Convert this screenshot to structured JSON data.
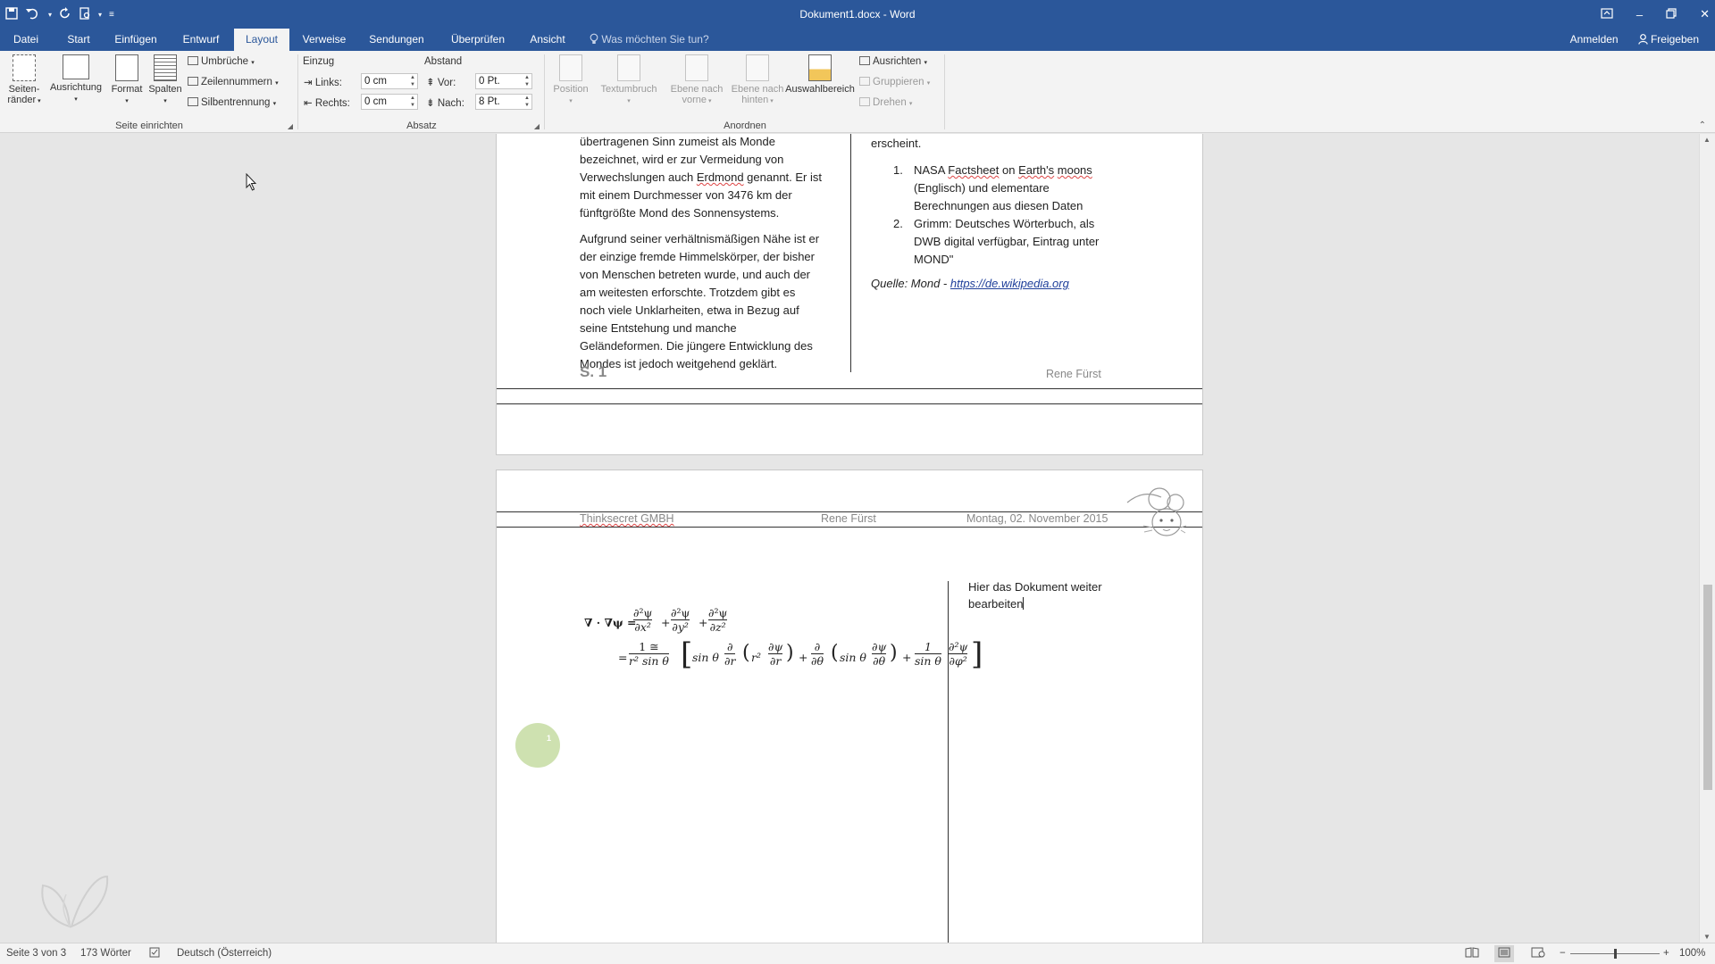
{
  "app": {
    "window_title": "Dokument1.docx - Word",
    "quick_access": [
      "save-icon",
      "undo-icon",
      "redo-icon",
      "print-preview-icon",
      "customize-icon"
    ],
    "window_controls": [
      "ribbon-display-icon",
      "minimize-icon",
      "restore-icon",
      "close-icon"
    ]
  },
  "tabs": {
    "items": [
      "Datei",
      "Start",
      "Einfügen",
      "Entwurf",
      "Layout",
      "Verweise",
      "Sendungen",
      "Überprüfen",
      "Ansicht"
    ],
    "active": "Layout",
    "tell_me": "Was möchten Sie tun?",
    "signin": "Anmelden",
    "share": "Freigeben"
  },
  "ribbon": {
    "page_setup": {
      "label": "Seite einrichten",
      "margins_line1": "Seiten-",
      "margins_line2": "ränder",
      "orientation": "Ausrichtung",
      "size": "Format",
      "columns": "Spalten",
      "breaks": "Umbrüche",
      "line_numbers": "Zeilennummern",
      "hyphenation": "Silbentrennung"
    },
    "paragraph": {
      "label": "Absatz",
      "indent_title": "Einzug",
      "spacing_title": "Abstand",
      "left_label": "Links:",
      "left_value": "0 cm",
      "right_label": "Rechts:",
      "right_value": "0 cm",
      "before_label": "Vor:",
      "before_value": "0 Pt.",
      "after_label": "Nach:",
      "after_value": "8 Pt."
    },
    "arrange": {
      "label": "Anordnen",
      "position": "Position",
      "wrap": "Textumbruch",
      "forward_line1": "Ebene nach",
      "forward_line2": "vorne",
      "backward_line1": "Ebene nach",
      "backward_line2": "hinten",
      "selection_pane": "Auswahlbereich",
      "align": "Ausrichten",
      "group": "Gruppieren",
      "rotate": "Drehen"
    }
  },
  "page1": {
    "left_paragraph1": [
      "übertragenen Sinn zumeist als Monde",
      "bezeichnet, wird er zur Vermeidung von",
      "Verwechslungen auch Erdmond genannt. Er ist",
      "mit einem Durchmesser von 3476 km der",
      "fünftgrößte Mond des Sonnensystems."
    ],
    "left_paragraph2": [
      "Aufgrund seiner verhältnismäßigen Nähe ist er",
      "der einzige fremde Himmelskörper, der bisher",
      "von Menschen betreten wurde, und auch der",
      "am weitesten erforschte. Trotzdem gibt es",
      "noch viele Unklarheiten, etwa in Bezug auf",
      "seine Entstehung und manche",
      "Geländeformen. Die jüngere Entwicklung des",
      "Mondes ist jedoch weitgehend geklärt."
    ],
    "right_top": "erscheint.",
    "list": [
      {
        "num": "1.",
        "lines": [
          "NASA Factsheet on Earth's moons",
          "(Englisch) und elementare",
          "Berechnungen aus diesen Daten"
        ]
      },
      {
        "num": "2.",
        "lines": [
          "Grimm: Deutsches Wörterbuch, als",
          "DWB digital verfügbar, Eintrag unter",
          "MOND\""
        ]
      }
    ],
    "source_prefix": "Quelle: Mond - ",
    "source_link": "https://de.wikipedia.org",
    "footer_page": "S. 1",
    "footer_author": "Rene Fürst"
  },
  "page2": {
    "header_company": "Thinksecret GMBH",
    "header_author": "Rene Fürst",
    "header_date": "Montag, 02. November 2015",
    "right_text_line1": "Hier das Dokument weiter",
    "right_text_line2": "bearbeiten",
    "bubble_label": "1"
  },
  "equation": {
    "nabla_lhs": "∇ · ∇ψ =",
    "partial_num": "∂²ψ",
    "dx2": "∂x²",
    "dy2": "∂y²",
    "dz2": "∂z²",
    "plus": "+",
    "eq2": "=",
    "frac1_num": "1 ≅",
    "frac1_den": "r² sin θ",
    "sin_theta": "sin θ",
    "d": "∂",
    "dr": "∂r",
    "dtheta": "∂θ",
    "r2": "r²",
    "dpsi": "∂ψ",
    "one": "1",
    "sintheta_den": "sin θ",
    "d2psi": "∂²ψ",
    "dphi2": "∂φ²",
    "lparen": "(",
    "rparen": ")",
    "lbrack": "[",
    "rbrack": "]"
  },
  "statusbar": {
    "page": "Seite 3 von 3",
    "words": "173 Wörter",
    "language": "Deutsch (Österreich)",
    "zoom": "100%",
    "zoom_level": 0.5
  }
}
